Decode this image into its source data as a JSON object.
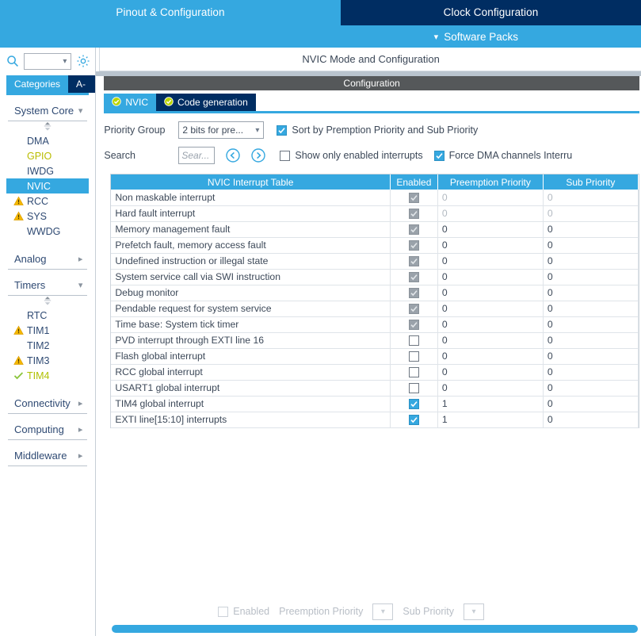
{
  "top_tabs": [
    {
      "label": "Pinout & Configuration",
      "selected": true
    },
    {
      "label": "Clock Configuration",
      "selected": false
    }
  ],
  "software_packs": {
    "label": "Software Packs",
    "chevron": "chevron-down-icon"
  },
  "sidebar": {
    "search": {
      "value": "",
      "placeholder": "",
      "icon": "search-icon"
    },
    "gear": "gear-icon",
    "tabs": [
      {
        "label": "Categories",
        "selected": true
      },
      {
        "label": "A->Z",
        "selected": false
      }
    ],
    "groups": [
      {
        "label": "System Core",
        "expanded": true,
        "arrow": "chevron-down-icon",
        "items": [
          {
            "label": "DMA",
            "state": "none",
            "selected": false
          },
          {
            "label": "GPIO",
            "state": "configured",
            "selected": false
          },
          {
            "label": "IWDG",
            "state": "none",
            "selected": false
          },
          {
            "label": "NVIC",
            "state": "none",
            "selected": true
          },
          {
            "label": "RCC",
            "state": "warning",
            "selected": false
          },
          {
            "label": "SYS",
            "state": "warning",
            "selected": false
          },
          {
            "label": "WWDG",
            "state": "none",
            "selected": false
          }
        ]
      },
      {
        "label": "Analog",
        "expanded": false,
        "arrow": "chevron-right-icon",
        "items": []
      },
      {
        "label": "Timers",
        "expanded": true,
        "arrow": "chevron-down-icon",
        "items": [
          {
            "label": "RTC",
            "state": "none",
            "selected": false
          },
          {
            "label": "TIM1",
            "state": "warning",
            "selected": false
          },
          {
            "label": "TIM2",
            "state": "none",
            "selected": false
          },
          {
            "label": "TIM3",
            "state": "warning",
            "selected": false
          },
          {
            "label": "TIM4",
            "state": "ok",
            "selected": false
          }
        ]
      },
      {
        "label": "Connectivity",
        "expanded": false,
        "arrow": "chevron-right-icon",
        "items": []
      },
      {
        "label": "Computing",
        "expanded": false,
        "arrow": "chevron-right-icon",
        "items": []
      },
      {
        "label": "Middleware",
        "expanded": false,
        "arrow": "chevron-right-icon",
        "items": []
      }
    ]
  },
  "main": {
    "mode_title": "NVIC Mode and Configuration",
    "configuration_title": "Configuration",
    "tabs": [
      {
        "label": "NVIC",
        "selected": true,
        "icon": "check-circle-icon"
      },
      {
        "label": "Code generation",
        "selected": false,
        "icon": "check-circle-icon"
      }
    ],
    "controls": {
      "priority_group_label": "Priority Group",
      "priority_group_value": "2 bits for pre...",
      "priority_group_chevron": "chevron-down-icon",
      "sort_checkbox_label": "Sort by Premption Priority and Sub Priority",
      "sort_checkbox_checked": true,
      "search_label": "Search",
      "search_value": "",
      "search_placeholder": "Sear...",
      "prev_icon": "arrow-left-circle-icon",
      "next_icon": "arrow-right-circle-icon",
      "show_enabled_label": "Show only enabled interrupts",
      "show_enabled_checked": false,
      "force_dma_label": "Force DMA channels Interru",
      "force_dma_checked": true
    },
    "table": {
      "headers": [
        "NVIC Interrupt Table",
        "Enabled",
        "Preemption Priority",
        "Sub Priority"
      ],
      "rows": [
        {
          "name": "Non maskable interrupt",
          "enabled": "locked",
          "preemption": "0",
          "sub": "0",
          "dim": true
        },
        {
          "name": "Hard fault interrupt",
          "enabled": "locked",
          "preemption": "0",
          "sub": "0",
          "dim": true
        },
        {
          "name": "Memory management fault",
          "enabled": "locked",
          "preemption": "0",
          "sub": "0",
          "dim": false
        },
        {
          "name": "Prefetch fault, memory access fault",
          "enabled": "locked",
          "preemption": "0",
          "sub": "0",
          "dim": false
        },
        {
          "name": "Undefined instruction or illegal state",
          "enabled": "locked",
          "preemption": "0",
          "sub": "0",
          "dim": false
        },
        {
          "name": "System service call via SWI instruction",
          "enabled": "locked",
          "preemption": "0",
          "sub": "0",
          "dim": false
        },
        {
          "name": "Debug monitor",
          "enabled": "locked",
          "preemption": "0",
          "sub": "0",
          "dim": false
        },
        {
          "name": "Pendable request for system service",
          "enabled": "locked",
          "preemption": "0",
          "sub": "0",
          "dim": false
        },
        {
          "name": "Time base: System tick timer",
          "enabled": "locked",
          "preemption": "0",
          "sub": "0",
          "dim": false
        },
        {
          "name": "PVD interrupt through EXTI line 16",
          "enabled": "unchecked",
          "preemption": "0",
          "sub": "0",
          "dim": false
        },
        {
          "name": "Flash global interrupt",
          "enabled": "unchecked",
          "preemption": "0",
          "sub": "0",
          "dim": false
        },
        {
          "name": "RCC global interrupt",
          "enabled": "unchecked",
          "preemption": "0",
          "sub": "0",
          "dim": false
        },
        {
          "name": "USART1 global interrupt",
          "enabled": "unchecked",
          "preemption": "0",
          "sub": "0",
          "dim": false
        },
        {
          "name": "TIM4 global interrupt",
          "enabled": "checked",
          "preemption": "1",
          "sub": "0",
          "dim": false
        },
        {
          "name": "EXTI line[15:10] interrupts",
          "enabled": "checked",
          "preemption": "1",
          "sub": "0",
          "dim": false
        }
      ]
    },
    "footer": {
      "enabled_label": "Enabled",
      "enabled_checked": false,
      "preemption_label": "Preemption Priority",
      "preemption_value": "",
      "sub_label": "Sub Priority",
      "sub_value": "",
      "chevron": "chevron-down-icon"
    }
  },
  "colors": {
    "accent_blue": "#35a8e0",
    "dark_navy": "#002d62",
    "config_grey": "#55585a",
    "warning_yellow": "#f0b400",
    "ok_green": "#8cc63e",
    "configured_text": "#b9bc00"
  }
}
